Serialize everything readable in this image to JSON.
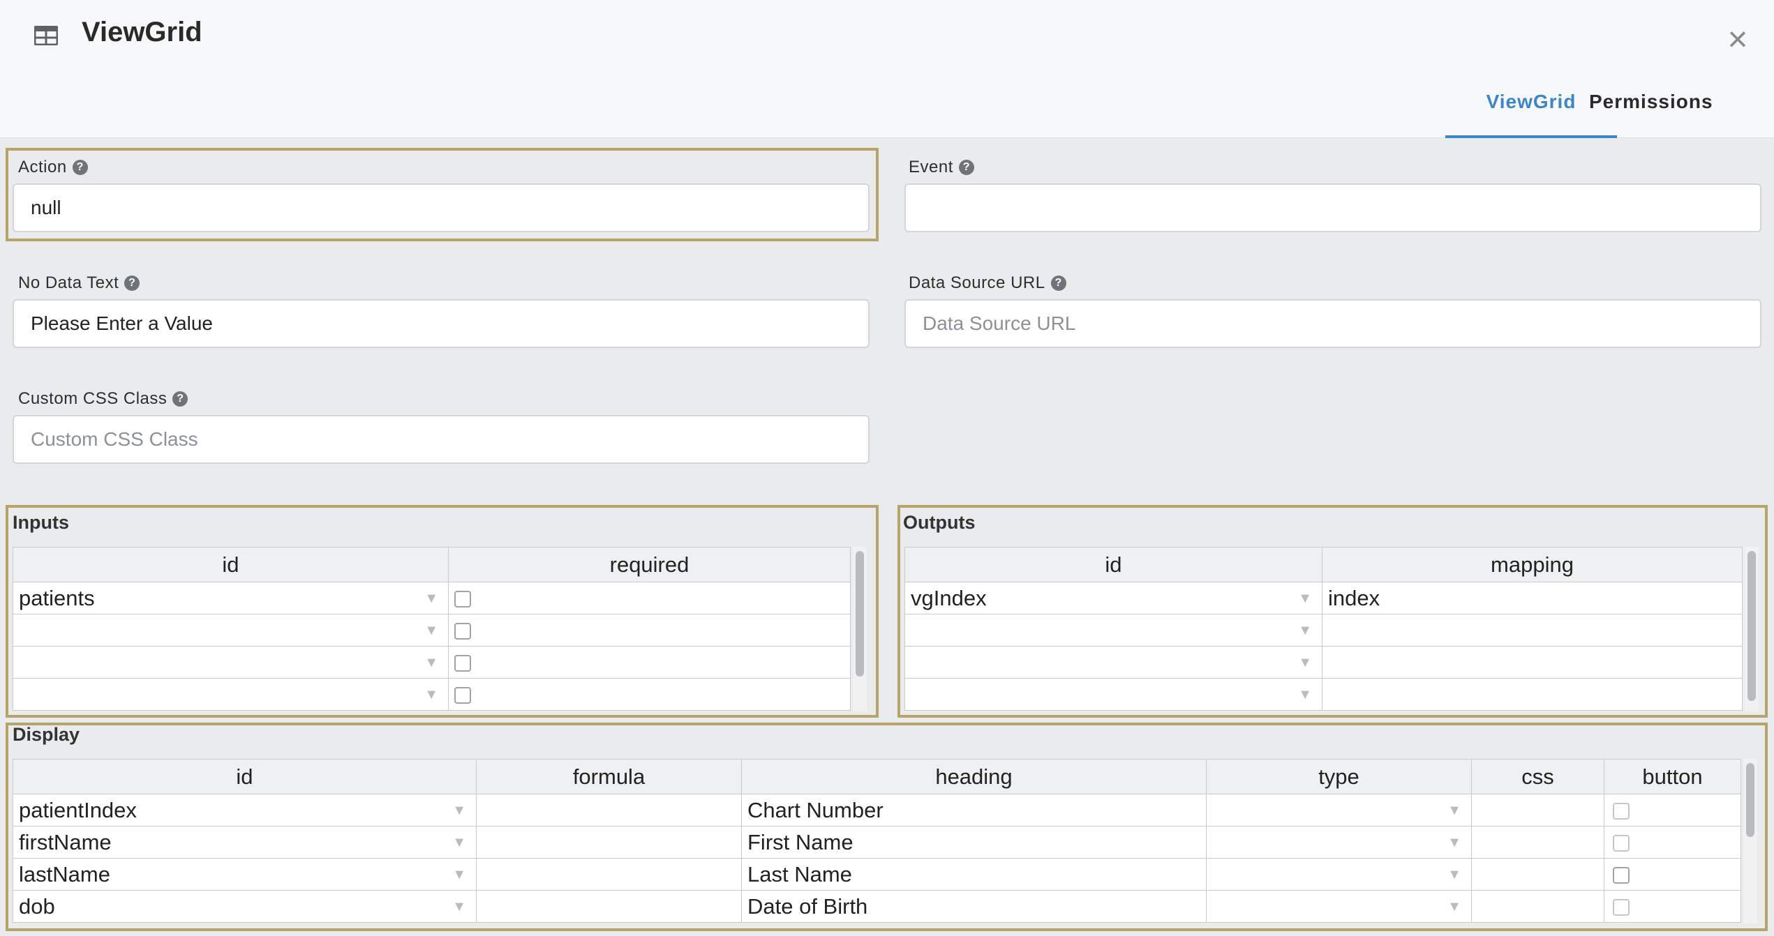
{
  "header": {
    "title": "ViewGrid",
    "tabs": [
      {
        "label": "ViewGrid",
        "active": true
      },
      {
        "label": "Permissions",
        "active": false
      }
    ]
  },
  "fields": {
    "action": {
      "label": "Action",
      "value": "null"
    },
    "event": {
      "label": "Event",
      "value": ""
    },
    "no_data_text": {
      "label": "No Data Text",
      "value": "Please Enter a Value"
    },
    "data_source_url": {
      "label": "Data Source URL",
      "placeholder": "Data Source URL",
      "value": ""
    },
    "custom_css_class": {
      "label": "Custom CSS Class",
      "placeholder": "Custom CSS Class",
      "value": ""
    }
  },
  "inputs": {
    "title": "Inputs",
    "columns": [
      "id",
      "required"
    ],
    "rows": [
      {
        "id": "patients",
        "required": false
      },
      {
        "id": "",
        "required": false
      },
      {
        "id": "",
        "required": false
      },
      {
        "id": "",
        "required": false
      }
    ]
  },
  "outputs": {
    "title": "Outputs",
    "columns": [
      "id",
      "mapping"
    ],
    "rows": [
      {
        "id": "vgIndex",
        "mapping": "index"
      },
      {
        "id": "",
        "mapping": ""
      },
      {
        "id": "",
        "mapping": ""
      },
      {
        "id": "",
        "mapping": ""
      }
    ]
  },
  "display": {
    "title": "Display",
    "columns": [
      "id",
      "formula",
      "heading",
      "type",
      "css",
      "button"
    ],
    "rows": [
      {
        "id": "patientIndex",
        "formula": "",
        "heading": "Chart Number",
        "type": "",
        "css": "",
        "button": false
      },
      {
        "id": "firstName",
        "formula": "",
        "heading": "First Name",
        "type": "",
        "css": "",
        "button": false
      },
      {
        "id": "lastName",
        "formula": "",
        "heading": "Last Name",
        "type": "",
        "css": "",
        "button": false
      },
      {
        "id": "dob",
        "formula": "",
        "heading": "Date of Birth",
        "type": "",
        "css": "",
        "button": false
      }
    ]
  },
  "icons": {
    "title": "table-icon",
    "close": "close-icon",
    "help": "help-icon",
    "dropdown": "dropdown-arrow-icon"
  },
  "colors": {
    "accent": "#3d86c6",
    "highlight_border": "#b5a56b",
    "background": "#e9ebed"
  }
}
